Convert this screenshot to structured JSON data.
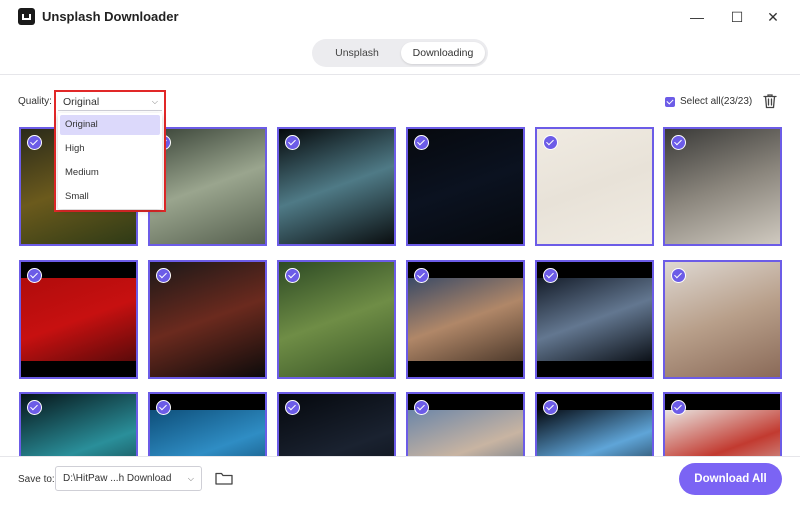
{
  "app": {
    "title": "Unsplash Downloader"
  },
  "window_controls": {
    "minimize": "—",
    "maximize": "☐",
    "close": "✕"
  },
  "tabs": [
    {
      "label": "Unsplash",
      "active": false
    },
    {
      "label": "Downloading",
      "active": true
    }
  ],
  "toolbar": {
    "quality_label": "Quality:",
    "quality_value": "Original",
    "quality_options": [
      "Original",
      "High",
      "Medium",
      "Small"
    ],
    "select_all_label": "Select all(23/23)",
    "select_all_checked": true,
    "trash_icon": "trash-icon"
  },
  "photos": [
    {
      "desc": "colorful street art",
      "colors": [
        "#2a2a1a",
        "#6b5a1c",
        "#2e3a16"
      ]
    },
    {
      "desc": "abandoned corridor",
      "colors": [
        "#3a4438",
        "#9aa58e",
        "#56604f"
      ]
    },
    {
      "desc": "3d abstract sculpture",
      "colors": [
        "#05090b",
        "#4f7a86",
        "#0a0e10"
      ]
    },
    {
      "desc": "cocktail bar neon sign",
      "colors": [
        "#06090e",
        "#0b1220",
        "#06090e"
      ]
    },
    {
      "desc": "minimal object art",
      "colors": [
        "#f0ebe2",
        "#e8e2d8",
        "#f0ebe2"
      ]
    },
    {
      "desc": "woman holding round mirror",
      "colors": [
        "#3a3a38",
        "#8a857c",
        "#cfc9bf"
      ]
    },
    {
      "desc": "woman in red",
      "colors": [
        "#b00c0c",
        "#c71010",
        "#5b0a0a"
      ]
    },
    {
      "desc": "sculpture with red light",
      "colors": [
        "#1b1818",
        "#6b2a1e",
        "#0d0b0b"
      ]
    },
    {
      "desc": "woman in saree",
      "colors": [
        "#2d4a24",
        "#6f8d46",
        "#385526"
      ]
    },
    {
      "desc": "desert dunes at dusk",
      "colors": [
        "#3a4a66",
        "#b08768",
        "#4e3a2c"
      ]
    },
    {
      "desc": "lake at dusk",
      "colors": [
        "#151d2a",
        "#637790",
        "#0c1118"
      ]
    },
    {
      "desc": "woman relaxing on couch",
      "colors": [
        "#ded8d2",
        "#b89f8a",
        "#8a6a58"
      ]
    },
    {
      "desc": "swirling particle art",
      "colors": [
        "#061418",
        "#2a8f9a",
        "#061418"
      ]
    },
    {
      "desc": "underwater diver",
      "colors": [
        "#0e4f7a",
        "#2f8dc4",
        "#0a3a5c"
      ]
    },
    {
      "desc": "night sky stars",
      "colors": [
        "#05080d",
        "#1a2230",
        "#05080d"
      ]
    },
    {
      "desc": "beach sunset",
      "colors": [
        "#6c86a8",
        "#c8b4a2",
        "#3e5a7a"
      ]
    },
    {
      "desc": "light beam in cave",
      "colors": [
        "#050a12",
        "#5fa5d8",
        "#050a12"
      ]
    },
    {
      "desc": "red chair",
      "colors": [
        "#e9e6e2",
        "#c23a30",
        "#d8d4cf"
      ]
    }
  ],
  "bottom": {
    "save_to_label": "Save to:",
    "save_path": "D:\\HitPaw ...h Download",
    "download_all_label": "Download All"
  }
}
